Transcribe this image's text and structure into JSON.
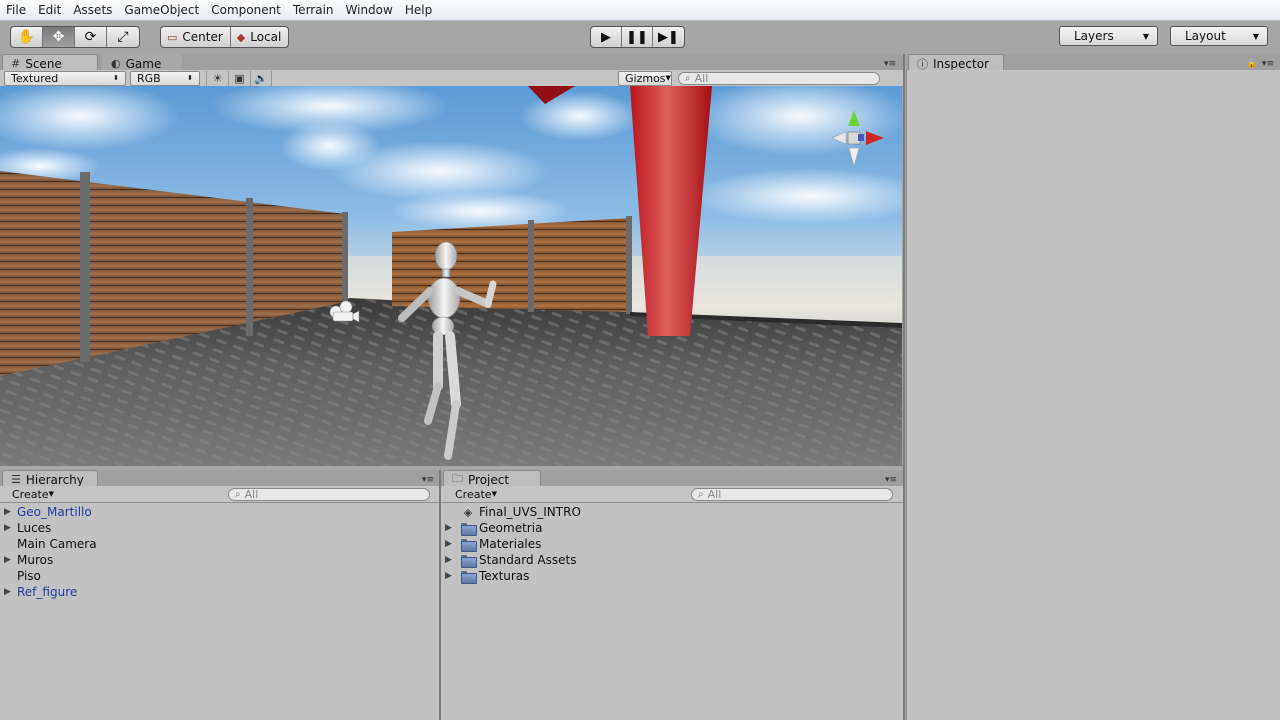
{
  "menu": [
    "File",
    "Edit",
    "Assets",
    "GameObject",
    "Component",
    "Terrain",
    "Window",
    "Help"
  ],
  "toolbar": {
    "transform_tools": [
      {
        "name": "hand-tool",
        "icon": "hand-icon",
        "glyph": "✋"
      },
      {
        "name": "move-tool",
        "icon": "move-icon",
        "glyph": "✥"
      },
      {
        "name": "rotate-tool",
        "icon": "rotate-icon",
        "glyph": "⟳"
      },
      {
        "name": "scale-tool",
        "icon": "scale-icon",
        "glyph": "⤢"
      }
    ],
    "pivot_label": "Center",
    "rotation_label": "Local",
    "layers_label": "Layers",
    "layout_label": "Layout"
  },
  "scene_tabs": {
    "scene_label": "Scene",
    "game_label": "Game"
  },
  "scene_bar": {
    "render_mode": "Textured",
    "channel": "RGB",
    "gizmos_label": "Gizmos",
    "search_placeholder": "All"
  },
  "inspector": {
    "tab_label": "Inspector"
  },
  "hierarchy": {
    "tab_label": "Hierarchy",
    "create_label": "Create",
    "search_placeholder": "All",
    "items": [
      {
        "label": "Geo_Martillo",
        "expandable": true,
        "prefab": true
      },
      {
        "label": "Luces",
        "expandable": true,
        "prefab": false
      },
      {
        "label": "Main Camera",
        "expandable": false,
        "prefab": false
      },
      {
        "label": "Muros",
        "expandable": true,
        "prefab": false
      },
      {
        "label": "Piso",
        "expandable": false,
        "prefab": false
      },
      {
        "label": "Ref_figure",
        "expandable": true,
        "prefab": true
      }
    ]
  },
  "project": {
    "tab_label": "Project",
    "create_label": "Create",
    "search_placeholder": "All",
    "items": [
      {
        "label": "Final_UVS_INTRO",
        "type": "scene"
      },
      {
        "label": "Geometria",
        "type": "folder"
      },
      {
        "label": "Materiales",
        "type": "folder"
      },
      {
        "label": "Standard Assets",
        "type": "folder"
      },
      {
        "label": "Texturas",
        "type": "folder"
      }
    ]
  },
  "colors": {
    "prefab_text": "#1f3f9e",
    "panel_bg": "#c2c2c2",
    "toolbar_bg": "#a6a6a6"
  }
}
